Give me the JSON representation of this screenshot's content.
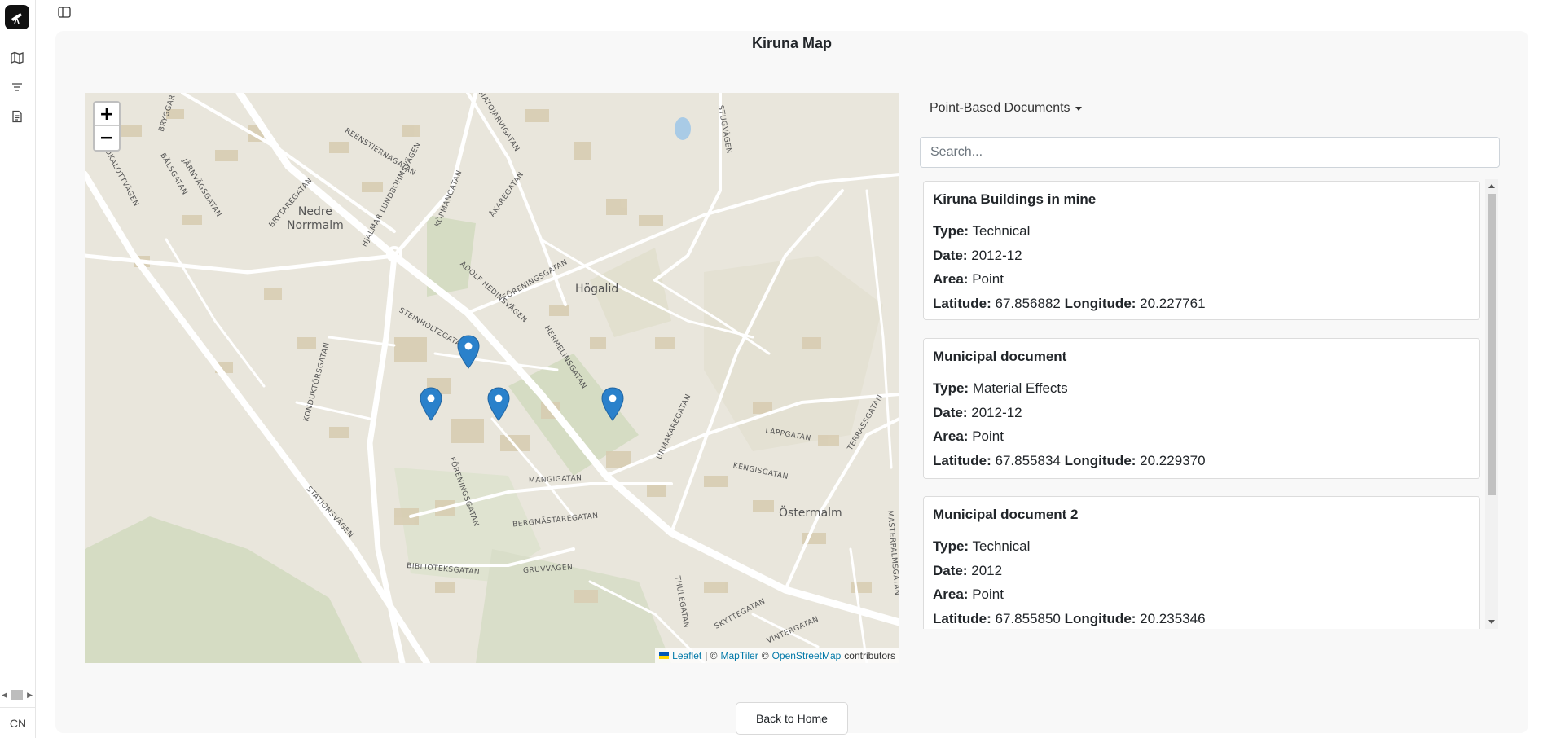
{
  "page": {
    "title": "Kiruna Map"
  },
  "rail": {
    "footer_label": "CN"
  },
  "map": {
    "zoom_in_label": "+",
    "zoom_out_label": "−",
    "street_labels": [
      "BRYGGAR",
      "NORDKALOTTVÄGEN",
      "BÄLSGATAN",
      "JÄRNVÄGSGATAN",
      "BRYTAREGATAN",
      "REENSTIERNAGATAN",
      "HJALMAR LUNDBOHMSVÄGEN",
      "KÖPMANGATAN",
      "MATOJÄRVIGATAN",
      "ÅKAREGATAN",
      "STUGVÄGEN",
      "ADOLF HEDINSVÄGEN",
      "FÖRENINGSGATAN",
      "STEINHOLTZGATAN",
      "HERMELINSGATAN",
      "KONDUKTÖRSGATAN",
      "MANGIGATAN",
      "BERGMÄSTAREGATAN",
      "BIBLIOTEKSGATAN",
      "GRUVVÄGEN",
      "STATIONSVÄGEN",
      "URMAKAREGATAN",
      "LAPPGATAN",
      "KENGISGATAN",
      "TERRASSGATAN",
      "THULEGATAN",
      "SKYTTEGATAN",
      "VINTERGATAN",
      "MASTERPALMSGATAN",
      "FÖRENINGSGATAN"
    ],
    "place_nedre": "Nedre\nNorrmalm",
    "place_hogalid": "Högalid",
    "place_ostermalm": "Östermalm",
    "attribution": {
      "leaflet": "Leaflet",
      "sep1": "| ©",
      "maptiler": "MapTiler",
      "sep2": "©",
      "osm": "OpenStreetMap",
      "contributors": "contributors"
    }
  },
  "filter": {
    "dropdown_label": "Point-Based Documents"
  },
  "search": {
    "placeholder": "Search..."
  },
  "field_labels": {
    "type": "Type:",
    "date": "Date:",
    "area": "Area:",
    "latitude": "Latitude:",
    "longitude": "Longitude:"
  },
  "documents": [
    {
      "title": "Kiruna Buildings in mine",
      "type": "Technical",
      "date": "2012-12",
      "area": "Point",
      "latitude": "67.856882",
      "longitude": "20.227761"
    },
    {
      "title": "Municipal document",
      "type": "Material Effects",
      "date": "2012-12",
      "area": "Point",
      "latitude": "67.855834",
      "longitude": "20.229370"
    },
    {
      "title": "Municipal document 2",
      "type": "Technical",
      "date": "2012",
      "area": "Point",
      "latitude": "67.855850",
      "longitude": "20.235346"
    }
  ],
  "footer": {
    "back_label": "Back to Home"
  },
  "colors": {
    "marker": "#2a81cb",
    "map_bg": "#e9e6dc",
    "park": "#d5dcc3",
    "road": "#ffffff"
  }
}
